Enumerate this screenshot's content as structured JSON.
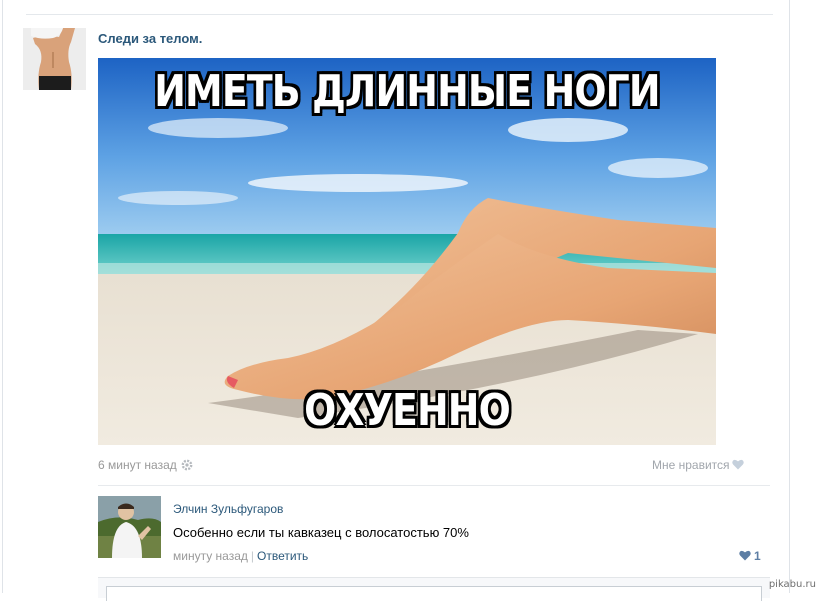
{
  "post": {
    "author": "Следи за телом.",
    "meme_top_text": "ИМЕТЬ ДЛИННЫЕ НОГИ",
    "meme_bottom_text": "ОХУЕННО",
    "time": "6 минут назад",
    "like_label": "Мне нравится",
    "icons": {
      "settings": "gear-icon",
      "like": "heart-icon"
    }
  },
  "comment": {
    "author": "Элчин Зульфугаров",
    "text": "Особенно если ты кавказец с волосатостью 70%",
    "time": "минуту назад",
    "separator": "|",
    "reply_label": "Ответить",
    "likes": "1"
  },
  "watermark": "pikabu.ru",
  "colors": {
    "link": "#2b587a",
    "muted": "#999999",
    "like_accent": "#5d7ea4"
  }
}
